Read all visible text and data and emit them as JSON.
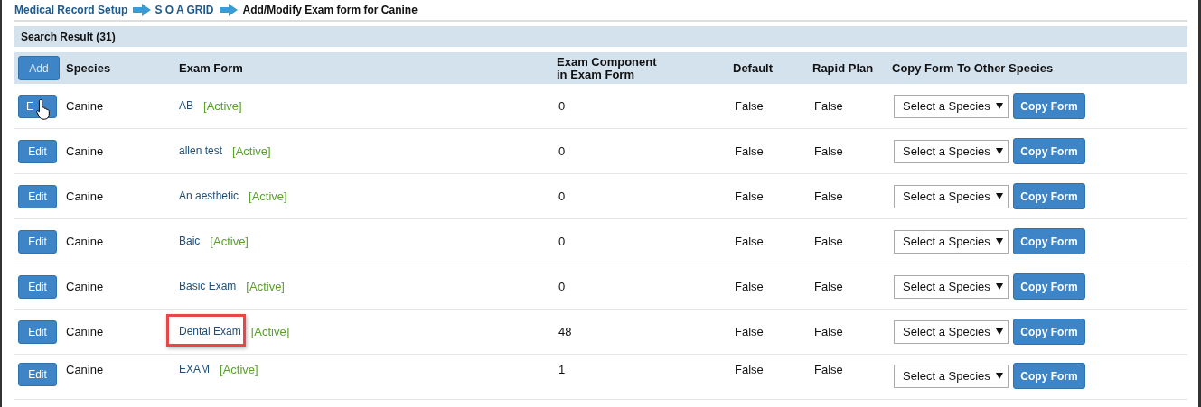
{
  "breadcrumb": [
    {
      "label": "Medical Record Setup",
      "link": true
    },
    {
      "label": "S O A GRID",
      "link": true
    },
    {
      "label": "Add/Modify Exam form for Canine",
      "link": false
    }
  ],
  "search_result": {
    "title": "Search Result (31)"
  },
  "table": {
    "add_button": "Add",
    "columns": [
      "Species",
      "Exam Form",
      "Exam Component\nin Exam Form",
      "Default",
      "Rapid Plan",
      "Copy Form To Other Species"
    ],
    "rows": [
      {
        "kind": "row",
        "edit": "E",
        "cursor": true,
        "species": "Canine",
        "form": "AB",
        "status": "[Active]",
        "count": "0",
        "default": "False",
        "rapid_plan": "False",
        "select": "Select a Species",
        "copy": "Copy Form",
        "highlighted": false
      },
      {
        "kind": "row",
        "edit": "Edit",
        "cursor": false,
        "species": "Canine",
        "form": "allen test",
        "status": "[Active]",
        "count": "0",
        "default": "False",
        "rapid_plan": "False",
        "select": "Select a Species",
        "copy": "Copy Form",
        "highlighted": false
      },
      {
        "kind": "row",
        "edit": "Edit",
        "cursor": false,
        "species": "Canine",
        "form": "An aesthetic",
        "status": "[Active]",
        "count": "0",
        "default": "False",
        "rapid_plan": "False",
        "select": "Select a Species",
        "copy": "Copy Form",
        "highlighted": false
      },
      {
        "kind": "row",
        "edit": "Edit",
        "cursor": false,
        "species": "Canine",
        "form": "Baic",
        "status": "[Active]",
        "count": "0",
        "default": "False",
        "rapid_plan": "False",
        "select": "Select a Species",
        "copy": "Copy Form",
        "highlighted": false
      },
      {
        "kind": "row",
        "edit": "Edit",
        "cursor": false,
        "species": "Canine",
        "form": "Basic Exam",
        "status": "[Active]",
        "count": "0",
        "default": "False",
        "rapid_plan": "False",
        "select": "Select a Species",
        "copy": "Copy Form",
        "highlighted": false
      },
      {
        "kind": "row",
        "edit": "Edit",
        "cursor": false,
        "species": "Canine",
        "form": "Dental Exam",
        "status": "[Active]",
        "count": "48",
        "default": "False",
        "rapid_plan": "False",
        "select": "Select a Species",
        "copy": "Copy Form",
        "highlighted": true
      },
      {
        "kind": "row",
        "edit": "Edit",
        "cursor": false,
        "species": "Canine",
        "form": "EXAM",
        "status": "[Active]",
        "count": "1",
        "default": "False",
        "rapid_plan": "False",
        "select": "Select a Species",
        "copy": "Copy Form",
        "highlighted": false
      }
    ]
  }
}
